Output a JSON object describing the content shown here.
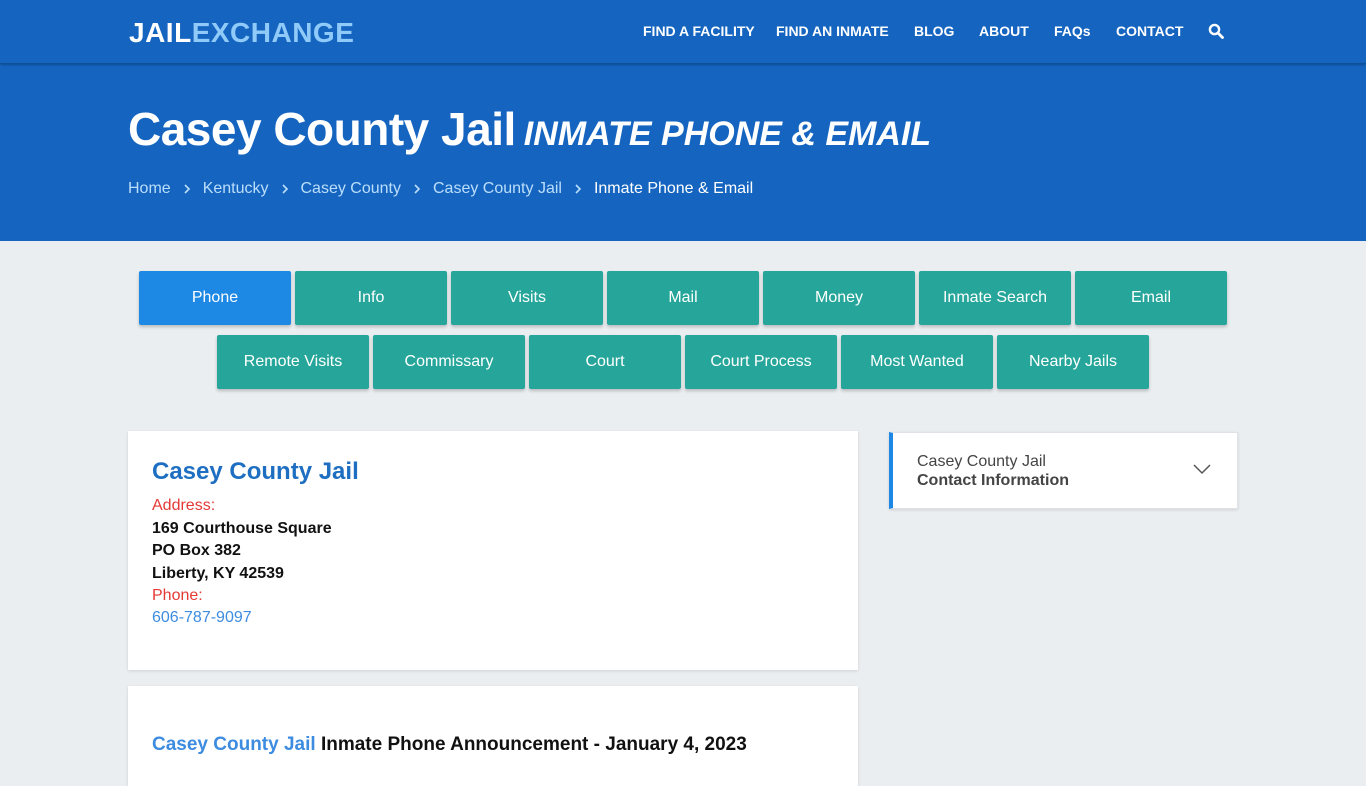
{
  "header": {
    "logo": {
      "part1": "JAIL",
      "part2": "EXCHANGE"
    },
    "nav": [
      {
        "label": "FIND A FACILITY"
      },
      {
        "label": "FIND AN INMATE"
      },
      {
        "label": "BLOG"
      },
      {
        "label": "ABOUT"
      },
      {
        "label": "FAQs"
      },
      {
        "label": "CONTACT"
      }
    ],
    "search_icon": "search-icon"
  },
  "hero": {
    "title": "Casey County Jail",
    "subtitle": "INMATE PHONE & EMAIL",
    "breadcrumb": [
      {
        "label": "Home"
      },
      {
        "label": "Kentucky"
      },
      {
        "label": "Casey County"
      },
      {
        "label": "Casey County Jail"
      },
      {
        "label": "Inmate Phone & Email"
      }
    ]
  },
  "tabs": {
    "row1": [
      {
        "label": "Phone",
        "active": true
      },
      {
        "label": "Info"
      },
      {
        "label": "Visits"
      },
      {
        "label": "Mail"
      },
      {
        "label": "Money"
      },
      {
        "label": "Inmate Search"
      },
      {
        "label": "Email"
      }
    ],
    "row2": [
      {
        "label": "Remote Visits"
      },
      {
        "label": "Commissary"
      },
      {
        "label": "Court"
      },
      {
        "label": "Court Process"
      },
      {
        "label": "Most Wanted"
      },
      {
        "label": "Nearby Jails"
      }
    ]
  },
  "facility": {
    "name": "Casey County Jail",
    "address_label": "Address:",
    "address_lines": [
      "169 Courthouse Square",
      "PO Box 382",
      "Liberty, KY 42539"
    ],
    "phone_label": "Phone:",
    "phone": "606-787-9097"
  },
  "announcement": {
    "highlight": "Casey County Jail",
    "text": " Inmate Phone Announcement - January 4, 2023"
  },
  "sidebar": {
    "line1": "Casey County Jail",
    "line2": "Contact Information",
    "toggle_icon": "chevron-down-icon"
  },
  "colors": {
    "header_blue": "#1565c0",
    "logo_accent": "#90caf9",
    "tab_teal": "#26a69a",
    "tab_active": "#1e88e5",
    "label_red": "#e53935",
    "link_blue": "#3d8ce0"
  }
}
